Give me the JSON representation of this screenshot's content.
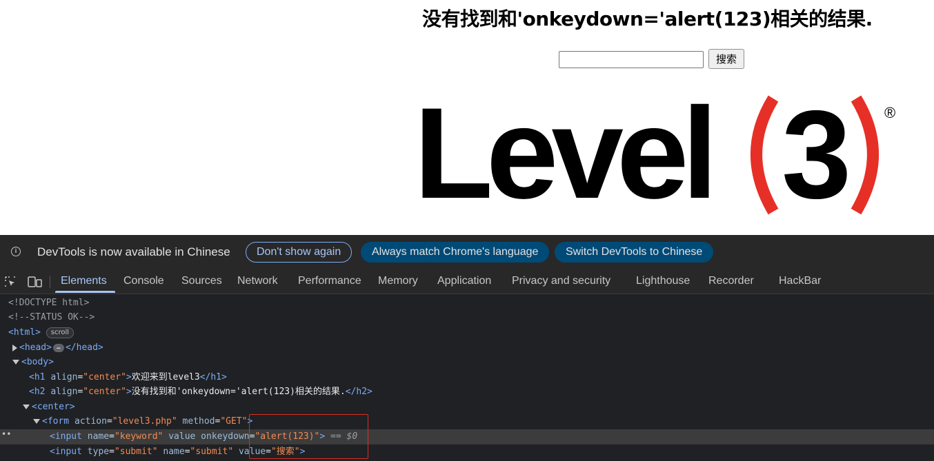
{
  "page": {
    "heading": "没有找到和'onkeydown='alert(123)相关的结果.",
    "search_value": "",
    "search_button": "搜索",
    "logo_text": "Level",
    "logo_number": "3",
    "logo_reg": "®"
  },
  "devtools": {
    "infobar": {
      "message": "DevTools is now available in Chinese",
      "btn_dont_show": "Don't show again",
      "btn_match_language": "Always match Chrome's language",
      "btn_switch": "Switch DevTools to Chinese"
    },
    "tabs": [
      "Elements",
      "Console",
      "Sources",
      "Network",
      "Performance",
      "Memory",
      "Application",
      "Privacy and security",
      "Lighthouse",
      "Recorder",
      "HackBar"
    ],
    "active_tab": "Elements",
    "dom": {
      "doctype": "<!DOCTYPE html>",
      "comment": "<!--STATUS OK-->",
      "html_open": "<html>",
      "scroll_badge": "scroll",
      "head_open": "<head>",
      "head_ellipsis": "…",
      "head_close": "</head>",
      "body_open": "<body>",
      "h1_open": "<h1",
      "h1_attr": "align",
      "h1_val": "\"center\"",
      "h1_text": "欢迎来到level3",
      "h1_close": "</h1>",
      "h2_open": "<h2",
      "h2_attr": "align",
      "h2_val": "\"center\"",
      "h2_text": "没有找到和'onkeydown='alert(123)相关的结果.",
      "h2_close": "</h2>",
      "center_open": "<center>",
      "form_open": "<form",
      "form_attr1": "action",
      "form_val1": "\"level3.php\"",
      "form_attr2": "method",
      "form_val2": "\"GET\"",
      "input1_open": "<input",
      "input1_attr1": "name",
      "input1_val1": "\"keyword\"",
      "input1_attr2": "value onkeydown",
      "input1_val2": "\"alert(123)\"",
      "input1_suffix": "== $0",
      "input2_open": "<input",
      "input2_attr1": "type",
      "input2_val1": "\"submit\"",
      "input2_attr2": "name",
      "input2_val2": "\"submit\"",
      "input2_attr3": "value",
      "input2_val3": "\"搜索\""
    }
  },
  "colors": {
    "logo_black": "#000000",
    "logo_red": "#e63027",
    "highlight_box": "#d93025",
    "active_tab": "#a8c7fa"
  }
}
